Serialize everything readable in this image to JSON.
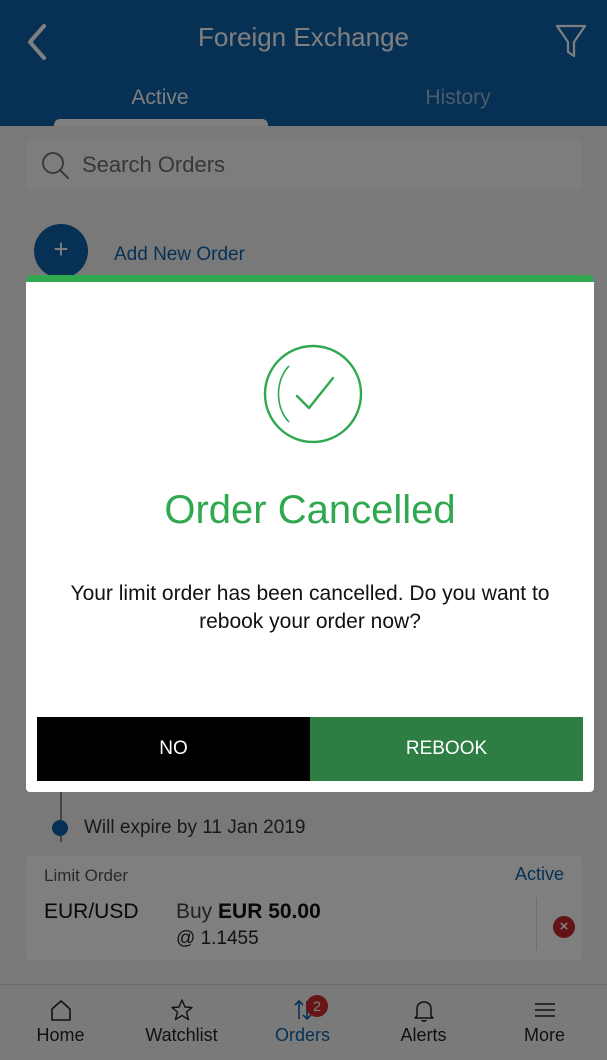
{
  "header": {
    "title": "Foreign Exchange",
    "tabs": [
      {
        "label": "Active",
        "selected": true
      },
      {
        "label": "History",
        "selected": false
      }
    ]
  },
  "search": {
    "placeholder": "Search Orders"
  },
  "add_order": {
    "label": "Add New Order"
  },
  "timeline": {
    "expire_text": "Will expire by 11 Jan 2019"
  },
  "order": {
    "type": "Limit Order",
    "status": "Active",
    "pair": "EUR/USD",
    "side": "Buy",
    "amount": "EUR 50.00",
    "rate": "@ 1.1455"
  },
  "modal": {
    "title": "Order Cancelled",
    "message": "Your limit order has been cancelled. Do you want to rebook your order now?",
    "no_label": "NO",
    "rebook_label": "REBOOK"
  },
  "bottom_nav": [
    {
      "label": "Home",
      "icon": "home-icon"
    },
    {
      "label": "Watchlist",
      "icon": "star-icon"
    },
    {
      "label": "Orders",
      "icon": "orders-icon",
      "badge": "2",
      "active": true
    },
    {
      "label": "Alerts",
      "icon": "bell-icon"
    },
    {
      "label": "More",
      "icon": "menu-icon"
    }
  ],
  "colors": {
    "brand_blue": "#0f62a8",
    "success_green": "#2fa84f",
    "rebook_green": "#2e7d43",
    "danger_red": "#c6262c"
  }
}
